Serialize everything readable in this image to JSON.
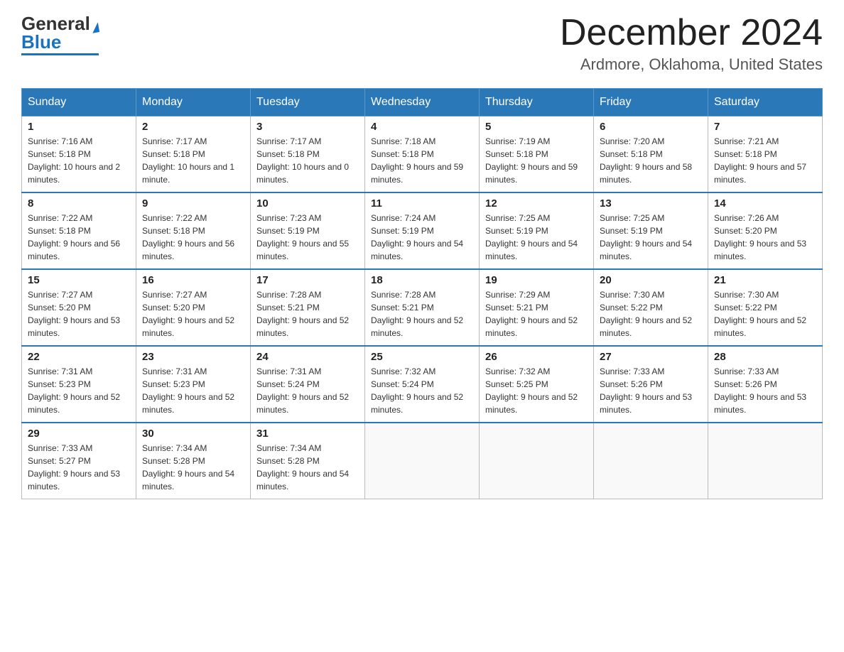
{
  "header": {
    "logo": {
      "general": "General",
      "blue": "Blue"
    },
    "month_title": "December 2024",
    "location": "Ardmore, Oklahoma, United States"
  },
  "calendar": {
    "days_of_week": [
      "Sunday",
      "Monday",
      "Tuesday",
      "Wednesday",
      "Thursday",
      "Friday",
      "Saturday"
    ],
    "weeks": [
      [
        {
          "day": "1",
          "sunrise": "7:16 AM",
          "sunset": "5:18 PM",
          "daylight": "10 hours and 2 minutes."
        },
        {
          "day": "2",
          "sunrise": "7:17 AM",
          "sunset": "5:18 PM",
          "daylight": "10 hours and 1 minute."
        },
        {
          "day": "3",
          "sunrise": "7:17 AM",
          "sunset": "5:18 PM",
          "daylight": "10 hours and 0 minutes."
        },
        {
          "day": "4",
          "sunrise": "7:18 AM",
          "sunset": "5:18 PM",
          "daylight": "9 hours and 59 minutes."
        },
        {
          "day": "5",
          "sunrise": "7:19 AM",
          "sunset": "5:18 PM",
          "daylight": "9 hours and 59 minutes."
        },
        {
          "day": "6",
          "sunrise": "7:20 AM",
          "sunset": "5:18 PM",
          "daylight": "9 hours and 58 minutes."
        },
        {
          "day": "7",
          "sunrise": "7:21 AM",
          "sunset": "5:18 PM",
          "daylight": "9 hours and 57 minutes."
        }
      ],
      [
        {
          "day": "8",
          "sunrise": "7:22 AM",
          "sunset": "5:18 PM",
          "daylight": "9 hours and 56 minutes."
        },
        {
          "day": "9",
          "sunrise": "7:22 AM",
          "sunset": "5:18 PM",
          "daylight": "9 hours and 56 minutes."
        },
        {
          "day": "10",
          "sunrise": "7:23 AM",
          "sunset": "5:19 PM",
          "daylight": "9 hours and 55 minutes."
        },
        {
          "day": "11",
          "sunrise": "7:24 AM",
          "sunset": "5:19 PM",
          "daylight": "9 hours and 54 minutes."
        },
        {
          "day": "12",
          "sunrise": "7:25 AM",
          "sunset": "5:19 PM",
          "daylight": "9 hours and 54 minutes."
        },
        {
          "day": "13",
          "sunrise": "7:25 AM",
          "sunset": "5:19 PM",
          "daylight": "9 hours and 54 minutes."
        },
        {
          "day": "14",
          "sunrise": "7:26 AM",
          "sunset": "5:20 PM",
          "daylight": "9 hours and 53 minutes."
        }
      ],
      [
        {
          "day": "15",
          "sunrise": "7:27 AM",
          "sunset": "5:20 PM",
          "daylight": "9 hours and 53 minutes."
        },
        {
          "day": "16",
          "sunrise": "7:27 AM",
          "sunset": "5:20 PM",
          "daylight": "9 hours and 52 minutes."
        },
        {
          "day": "17",
          "sunrise": "7:28 AM",
          "sunset": "5:21 PM",
          "daylight": "9 hours and 52 minutes."
        },
        {
          "day": "18",
          "sunrise": "7:28 AM",
          "sunset": "5:21 PM",
          "daylight": "9 hours and 52 minutes."
        },
        {
          "day": "19",
          "sunrise": "7:29 AM",
          "sunset": "5:21 PM",
          "daylight": "9 hours and 52 minutes."
        },
        {
          "day": "20",
          "sunrise": "7:30 AM",
          "sunset": "5:22 PM",
          "daylight": "9 hours and 52 minutes."
        },
        {
          "day": "21",
          "sunrise": "7:30 AM",
          "sunset": "5:22 PM",
          "daylight": "9 hours and 52 minutes."
        }
      ],
      [
        {
          "day": "22",
          "sunrise": "7:31 AM",
          "sunset": "5:23 PM",
          "daylight": "9 hours and 52 minutes."
        },
        {
          "day": "23",
          "sunrise": "7:31 AM",
          "sunset": "5:23 PM",
          "daylight": "9 hours and 52 minutes."
        },
        {
          "day": "24",
          "sunrise": "7:31 AM",
          "sunset": "5:24 PM",
          "daylight": "9 hours and 52 minutes."
        },
        {
          "day": "25",
          "sunrise": "7:32 AM",
          "sunset": "5:24 PM",
          "daylight": "9 hours and 52 minutes."
        },
        {
          "day": "26",
          "sunrise": "7:32 AM",
          "sunset": "5:25 PM",
          "daylight": "9 hours and 52 minutes."
        },
        {
          "day": "27",
          "sunrise": "7:33 AM",
          "sunset": "5:26 PM",
          "daylight": "9 hours and 53 minutes."
        },
        {
          "day": "28",
          "sunrise": "7:33 AM",
          "sunset": "5:26 PM",
          "daylight": "9 hours and 53 minutes."
        }
      ],
      [
        {
          "day": "29",
          "sunrise": "7:33 AM",
          "sunset": "5:27 PM",
          "daylight": "9 hours and 53 minutes."
        },
        {
          "day": "30",
          "sunrise": "7:34 AM",
          "sunset": "5:28 PM",
          "daylight": "9 hours and 54 minutes."
        },
        {
          "day": "31",
          "sunrise": "7:34 AM",
          "sunset": "5:28 PM",
          "daylight": "9 hours and 54 minutes."
        },
        null,
        null,
        null,
        null
      ]
    ]
  }
}
